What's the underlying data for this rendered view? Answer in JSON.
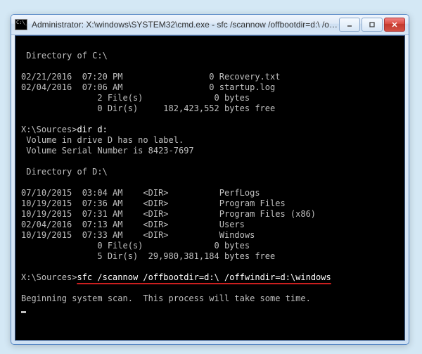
{
  "window": {
    "title": "Administrator: X:\\windows\\SYSTEM32\\cmd.exe - sfc  /scannow /offbootdir=d:\\ /offwindi..."
  },
  "terminal": {
    "dir_c_header": " Directory of C:\\",
    "c_listing": [
      "02/21/2016  07:20 PM                 0 Recovery.txt",
      "02/04/2016  07:06 AM                 0 startup.log",
      "               2 File(s)              0 bytes",
      "               0 Dir(s)     182,423,552 bytes free"
    ],
    "prompt1": "X:\\Sources>",
    "cmd1": "dir d:",
    "vol_line1": " Volume in drive D has no label.",
    "vol_line2": " Volume Serial Number is 8423-7697",
    "dir_d_header": " Directory of D:\\",
    "d_listing": [
      "07/10/2015  03:04 AM    <DIR>          PerfLogs",
      "10/19/2015  07:36 AM    <DIR>          Program Files",
      "10/19/2015  07:31 AM    <DIR>          Program Files (x86)",
      "02/04/2016  07:13 AM    <DIR>          Users",
      "10/19/2015  07:33 AM    <DIR>          Windows",
      "               0 File(s)              0 bytes",
      "               5 Dir(s)  29,980,381,184 bytes free"
    ],
    "prompt2": "X:\\Sources>",
    "cmd2": "sfc /scannow /offbootdir=d:\\ /offwindir=d:\\windows",
    "scan_msg": "Beginning system scan.  This process will take some time."
  }
}
